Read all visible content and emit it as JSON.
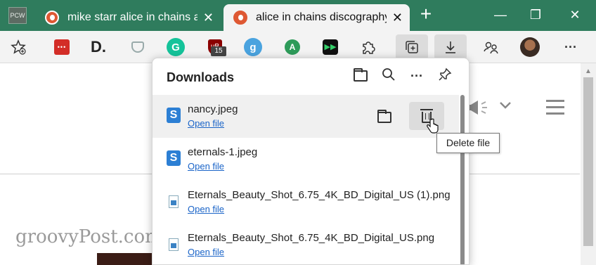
{
  "tabs": {
    "pcw_label": "PCW",
    "tab1_title": "mike starr alice in chains at",
    "tab2_title": "alice in chains discography",
    "close_glyph": "✕",
    "new_tab_glyph": "+"
  },
  "window": {
    "minimize": "—",
    "restore": "❐",
    "close": "✕"
  },
  "toolbar": {
    "lastpass_text": "•••",
    "d_text": "D.",
    "grammarly_text": "G",
    "ublock_text": "uB",
    "ublock_badge": "15",
    "g_text": "g",
    "a_text": "A",
    "play_text": "▶▶",
    "more_glyph": "···",
    "colors": {
      "grammarly": "#15c39a",
      "g_ext": "#4aa3df",
      "a_ext": "#2e9b5a"
    }
  },
  "page": {
    "logo_text": "groovyPost.com"
  },
  "downloads": {
    "title": "Downloads",
    "items": [
      {
        "name": "nancy.jpeg",
        "action": "Open file",
        "icon": "snagit-icon",
        "icon_text": "S"
      },
      {
        "name": "eternals-1.jpeg",
        "action": "Open file",
        "icon": "snagit-icon",
        "icon_text": "S"
      },
      {
        "name": "Eternals_Beauty_Shot_6.75_4K_BD_Digital_US (1).png",
        "action": "Open file",
        "icon": "image-file-icon"
      },
      {
        "name": "Eternals_Beauty_Shot_6.75_4K_BD_Digital_US.png",
        "action": "Open file",
        "icon": "image-file-icon"
      }
    ],
    "tooltip": "Delete file"
  }
}
